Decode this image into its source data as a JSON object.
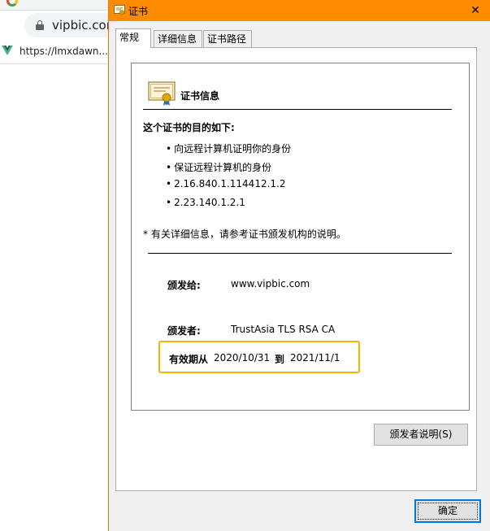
{
  "browser": {
    "address": "vipbic.com",
    "bookmark": "https://lmxdawn...."
  },
  "dialog": {
    "title": "证书",
    "close_glyph": "✕",
    "tabs": [
      {
        "label": "常规"
      },
      {
        "label": "详细信息"
      },
      {
        "label": "证书路径"
      }
    ],
    "info_heading": "证书信息",
    "purpose_heading": "这个证书的目的如下:",
    "purposes": [
      "向远程计算机证明你的身份",
      "保证远程计算机的身份",
      "2.16.840.1.114412.1.2",
      "2.23.140.1.2.1"
    ],
    "note": "* 有关详细信息，请参考证书颁发机构的说明。",
    "issued_to_label": "颁发给:",
    "issued_to": "www.vipbic.com",
    "issued_by_label": "颁发者:",
    "issued_by": "TrustAsia TLS RSA CA",
    "valid_from_label": "有效期从",
    "valid_from": "2020/10/31",
    "valid_to_label": "到",
    "valid_to": "2021/11/1",
    "issuer_statement_button": "颁发者说明(S)",
    "ok_button": "确定"
  },
  "colors": {
    "titlebar": "#ff8c00",
    "highlight": "#f4b400",
    "focus": "#0078d7"
  }
}
